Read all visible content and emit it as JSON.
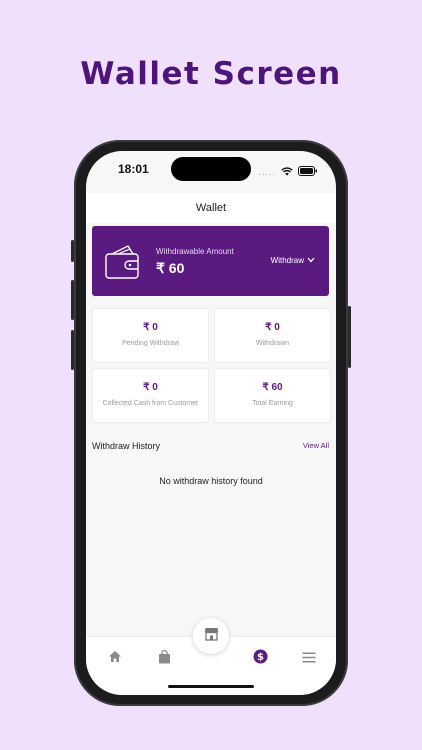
{
  "promo": {
    "title": "Wallet Screen"
  },
  "status_bar": {
    "time": "18:01",
    "signal_dots": "....."
  },
  "header": {
    "title": "Wallet"
  },
  "wallet_card": {
    "label": "Withdrawable Amount",
    "amount": "₹ 60",
    "withdraw_label": "Withdraw",
    "icon": "wallet-icon"
  },
  "stats": [
    {
      "value": "₹ 0",
      "label": "Pending Withdraw"
    },
    {
      "value": "₹ 0",
      "label": "Withdrawn"
    },
    {
      "value": "₹ 0",
      "label": "Collected Cash from Customer"
    },
    {
      "value": "₹ 60",
      "label": "Total Earning"
    }
  ],
  "history": {
    "title": "Withdraw History",
    "view_all": "View All",
    "empty_message": "No withdraw history found"
  },
  "bottom_nav": {
    "items": [
      "home-icon",
      "shopping-bag-icon",
      "store-icon",
      "dollar-icon",
      "menu-icon"
    ],
    "active": "dollar-icon"
  },
  "colors": {
    "background": "#f0e0fb",
    "brand": "#5b1a80",
    "title": "#4d1579",
    "inactive_icon": "#8a8a8a"
  }
}
